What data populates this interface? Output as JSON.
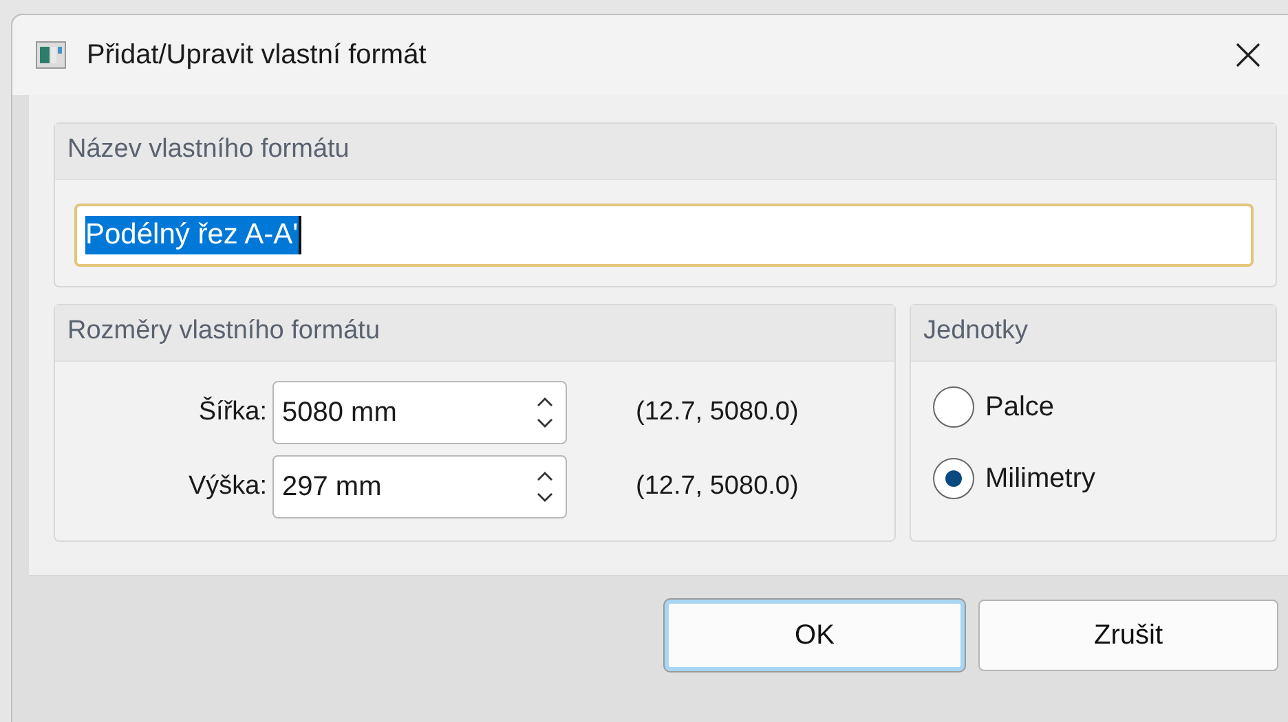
{
  "window": {
    "title": "Přidat/Upravit vlastní formát"
  },
  "name_group": {
    "title": "Název vlastního formátu",
    "field": {
      "value": "Podélný řez A-A'",
      "text_selected": true,
      "focused": true
    }
  },
  "dimensions_group": {
    "title": "Rozměry vlastního formátu",
    "rows": [
      {
        "label": "Šířka:",
        "value": "5080 mm",
        "range": "(12.7, 5080.0)"
      },
      {
        "label": "Výška:",
        "value": "297 mm",
        "range": "(12.7, 5080.0)"
      }
    ]
  },
  "units_group": {
    "title": "Jednotky",
    "options": [
      {
        "label": "Palce",
        "selected": false
      },
      {
        "label": "Milimetry",
        "selected": true
      }
    ]
  },
  "buttons": [
    {
      "label": "OK",
      "default": true
    },
    {
      "label": "Zrušit",
      "default": false
    }
  ]
}
